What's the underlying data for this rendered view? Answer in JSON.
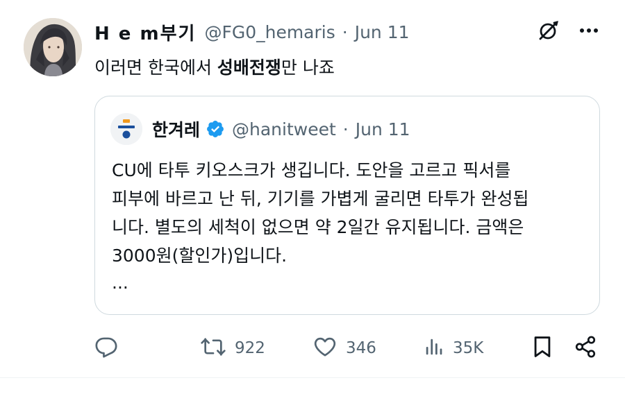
{
  "tweet": {
    "author": {
      "display_name": "H e m부기",
      "handle": "@FG0_hemaris",
      "separator": "·",
      "date": "Jun 11"
    },
    "text_before": "이러면 한국에서 ",
    "text_bold": "성배전쟁",
    "text_after": "만 나죠"
  },
  "quote": {
    "author": {
      "display_name": "한겨레",
      "handle": "@hanitweet",
      "separator": "·",
      "date": "Jun 11",
      "verified": true
    },
    "lines": [
      "CU에 타투 키오스크가 생깁니다. 도안을 고르고 픽서를",
      "피부에 바르고 난 뒤, 기기를 가볍게 굴리면 타투가 완성됩",
      "니다. 별도의 세척이 없으면 약 2일간 유지됩니다. 금액은",
      "3000원(할인가)입니다."
    ],
    "ellipsis": "..."
  },
  "actions": {
    "replies": {
      "icon": "reply-icon",
      "count": ""
    },
    "retweets": {
      "icon": "retweet-icon",
      "count": "922"
    },
    "likes": {
      "icon": "heart-icon",
      "count": "346"
    },
    "views": {
      "icon": "views-icon",
      "count": "35K"
    },
    "bookmark": {
      "icon": "bookmark-icon"
    },
    "share": {
      "icon": "share-icon"
    }
  },
  "colors": {
    "text": "#0f1419",
    "secondary": "#536471",
    "border": "#cfd9de",
    "verified": "#1d9bf0",
    "hani_orange": "#f29a1f",
    "hani_blue": "#1b4f9c"
  }
}
